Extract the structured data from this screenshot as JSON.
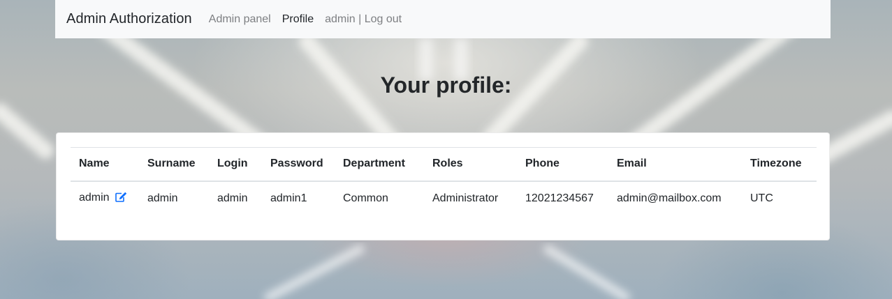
{
  "navbar": {
    "brand": "Admin Authorization",
    "links": [
      "Admin panel",
      "Profile"
    ],
    "active_link": "Profile",
    "user_logout": "admin | Log out"
  },
  "page": {
    "title": "Your profile:"
  },
  "table": {
    "headers": [
      "Name",
      "Surname",
      "Login",
      "Password",
      "Department",
      "Roles",
      "Phone",
      "Email",
      "Timezone"
    ],
    "row": [
      "admin",
      "admin",
      "admin",
      "admin1",
      "Common",
      "Administrator",
      "12021234567",
      "admin@mailbox.com",
      "UTC"
    ],
    "edit_icon": "edit-icon"
  },
  "colors": {
    "navbar_bg": "#f8f9fa",
    "link_muted": "#7d7f82",
    "edit_icon": "#0d6efd",
    "card_bg": "#ffffff"
  }
}
